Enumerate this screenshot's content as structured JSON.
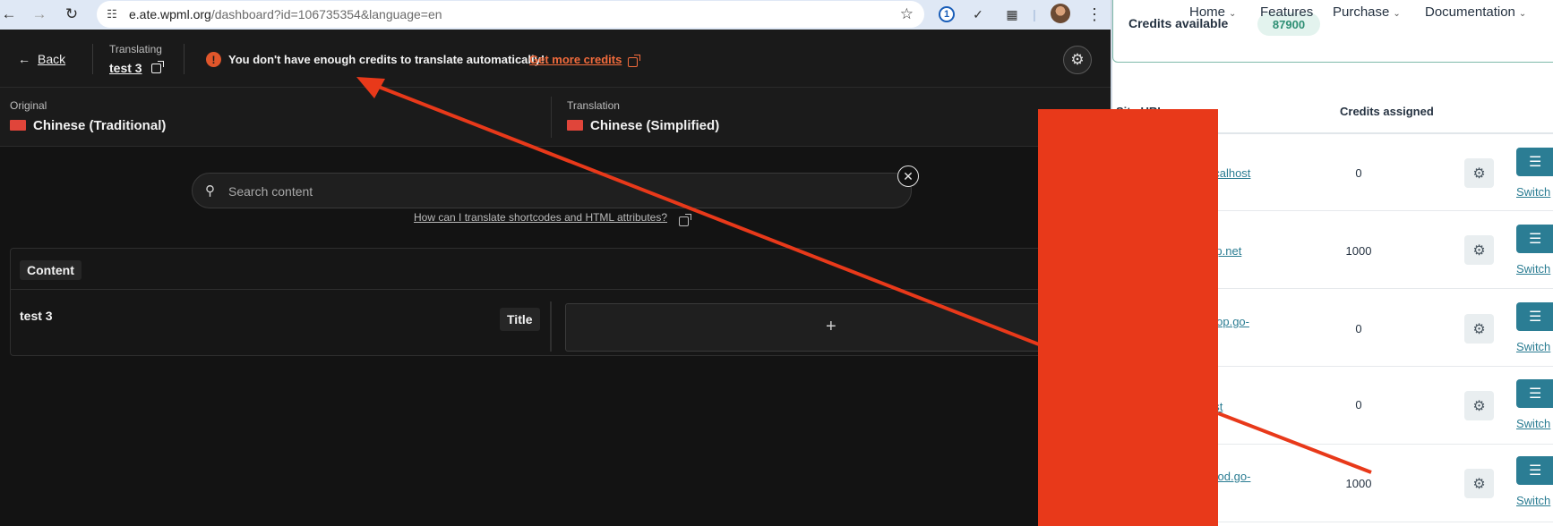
{
  "browser": {
    "url_host": "e.ate.wpml.org",
    "url_path": "/dashboard?id=106735354&language=en",
    "nav_back_icon": "arrow-left-icon",
    "nav_forward_icon": "arrow-right-icon",
    "reload_icon": "reload-icon"
  },
  "ate": {
    "back_label": "Back",
    "translating_label": "Translating",
    "translating_title": "test 3",
    "warning_text": "You don't have enough credits to translate automatically!",
    "warning_link": "Get more credits",
    "original_label": "Original",
    "original_language": "Chinese (Traditional)",
    "translation_label": "Translation",
    "translation_language": "Chinese (Simplified)",
    "search_placeholder": "Search content",
    "help_link": "How can I translate shortcodes and HTML attributes?",
    "section_label": "Content",
    "rows": [
      {
        "source": "test 3",
        "field": "Title",
        "target": "+"
      }
    ],
    "colors": {
      "background": "#131313",
      "warning": "#e0562b",
      "link": "#f26b3c"
    }
  },
  "site": {
    "nav": [
      {
        "label": "Home",
        "dropdown": true
      },
      {
        "label": "Features",
        "dropdown": false
      },
      {
        "label": "Purchase",
        "dropdown": true
      },
      {
        "label": "Documentation",
        "dropdown": true
      }
    ],
    "credits_available_label": "Credits available",
    "credits_available_value": "87900",
    "columns": {
      "site_url": "Site URL",
      "credits_assigned": "Credits assigned"
    },
    "rows": [
      {
        "url": "ocalhost",
        "credits": "0",
        "switch": "Switch"
      },
      {
        "url": "vip.net",
        "credits": "1000",
        "switch": "Switch"
      },
      {
        "url": "elop.go-",
        "credits": "0",
        "switch": "Switch"
      },
      {
        "url": "est",
        "credits": "0",
        "switch": "Switch"
      },
      {
        "url": "prod.go-",
        "credits": "1000",
        "switch": "Switch"
      }
    ],
    "colors": {
      "accent": "#2b7d94",
      "pill_bg": "#e3f3ee",
      "pill_text": "#2f8f74"
    }
  },
  "annotation": {
    "redaction_color": "#e8391a",
    "arrow_color": "#e8391a"
  }
}
